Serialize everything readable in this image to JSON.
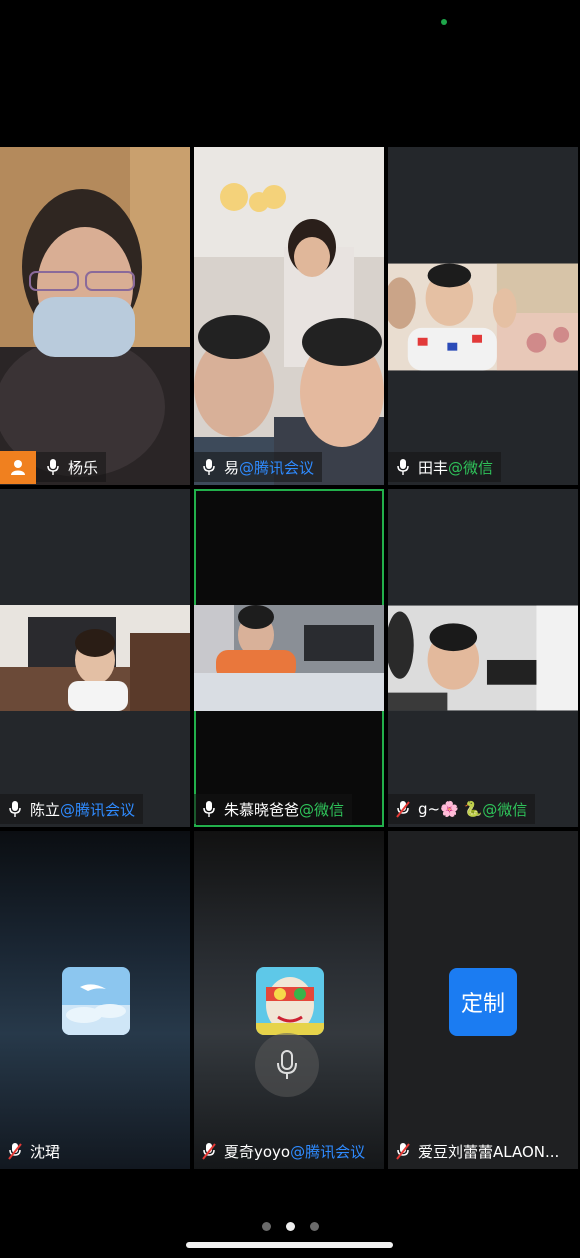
{
  "tiles": [
    {
      "name": "杨乐",
      "tag": "",
      "tag_color": "",
      "muted": false,
      "host": true
    },
    {
      "name": "易",
      "tag": "@腾讯会议",
      "tag_color": "blue",
      "muted": false
    },
    {
      "name": "田丰",
      "tag": "@微信",
      "tag_color": "green",
      "muted": false
    },
    {
      "name": "陈立",
      "tag": "@腾讯会议",
      "tag_color": "blue",
      "muted": false
    },
    {
      "name": "朱慕晓爸爸",
      "tag": "@微信",
      "tag_color": "green",
      "muted": false,
      "active": true
    },
    {
      "name": "g~🌸 🐍",
      "tag": "@微信",
      "tag_color": "green",
      "muted": true
    },
    {
      "name": "沈珺",
      "tag": "",
      "tag_color": "",
      "muted": true
    },
    {
      "name": "夏奇yoyo",
      "tag": "@腾讯会议",
      "tag_color": "blue",
      "muted": true
    },
    {
      "name": "爱豆刘蕾蕾ALAON...",
      "tag": "",
      "tag_color": "",
      "muted": true
    }
  ],
  "custom_button_label": "定制",
  "pager": {
    "count": 3,
    "current": 2
  },
  "colors": {
    "active_border": "#22b04b",
    "tag_blue": "#2f8bff",
    "tag_green": "#2fc35a",
    "host_badge": "#f0801f",
    "custom_button": "#1b7cf2"
  }
}
